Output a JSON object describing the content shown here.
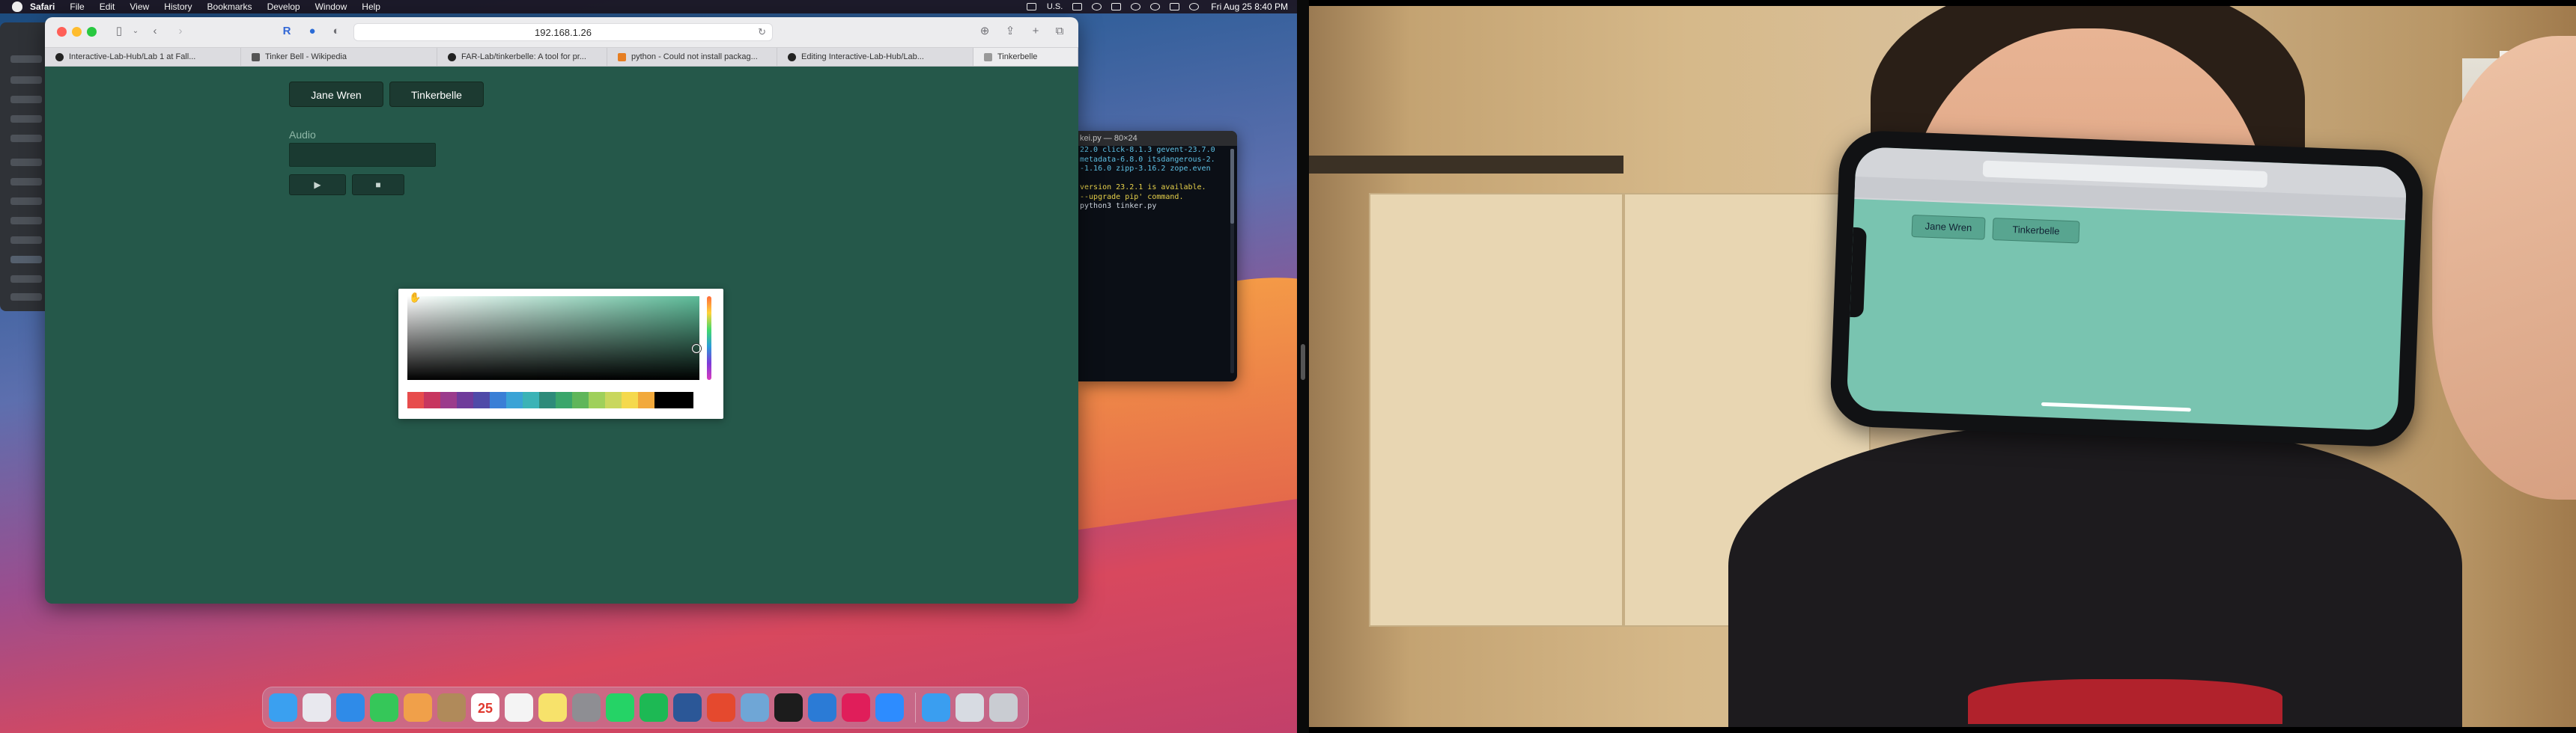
{
  "menubar": {
    "app_name": "Safari",
    "items": [
      "File",
      "Edit",
      "View",
      "History",
      "Bookmarks",
      "Develop",
      "Window",
      "Help"
    ],
    "input_language": "U.S.",
    "clock": "Fri Aug 25  8:40 PM"
  },
  "safari": {
    "address": "192.168.1.26",
    "tabs": [
      {
        "label": "Interactive-Lab-Hub/Lab 1 at Fall...",
        "favicon_color": "#222222"
      },
      {
        "label": "Tinker Bell - Wikipedia",
        "favicon_color": "#444444"
      },
      {
        "label": "FAR-Lab/tinkerbelle: A tool for pr...",
        "favicon_color": "#222222"
      },
      {
        "label": "python - Could not install packag...",
        "favicon_color": "#e67e22"
      },
      {
        "label": "Editing Interactive-Lab-Hub/Lab...",
        "favicon_color": "#222222"
      },
      {
        "label": "Tinkerbelle",
        "favicon_color": "#888888"
      }
    ]
  },
  "page": {
    "buttons": [
      "Jane Wren",
      "Tinkerbelle"
    ],
    "audio_label": "Audio",
    "play_icon": "play-icon",
    "stop_icon": "stop-icon",
    "background_color": "#25584a"
  },
  "color_picker": {
    "selected_hue_color": "#5cbb98",
    "swatches": [
      "#e74c4c",
      "#c7365f",
      "#9b3b8c",
      "#6f3b9b",
      "#4f4aa8",
      "#3a7fd6",
      "#3aa3d6",
      "#3bb3b6",
      "#2e8b7a",
      "#3aa66b",
      "#5fb65a",
      "#9fd05b",
      "#c9d75d",
      "#f5d94d",
      "#f2a93b",
      "#000000"
    ]
  },
  "terminal": {
    "title": "kei.py — 80×24",
    "lines": [
      {
        "text": "22.0 click-8.1.3 gevent-23.7.0",
        "color": "#5fc2e6"
      },
      {
        "text": "metadata-6.8.0 itsdangerous-2.",
        "color": "#5fc2e6"
      },
      {
        "text": "-1.16.0 zipp-3.16.2 zope.even",
        "color": "#5fc2e6"
      },
      {
        "text": "",
        "color": "#5fc2e6"
      },
      {
        "text": " version 23.2.1 is available.",
        "color": "#e7d14a"
      },
      {
        "text": "--upgrade pip' command.",
        "color": "#e7d14a"
      },
      {
        "text": "python3 tinker.py",
        "color": "#cfd6e0"
      }
    ]
  },
  "dock": {
    "apps": [
      {
        "name": "finder",
        "color": "#3aa0f0"
      },
      {
        "name": "launchpad",
        "color": "#e8e8ee"
      },
      {
        "name": "mail",
        "color": "#2f8be8"
      },
      {
        "name": "facetime",
        "color": "#35c759"
      },
      {
        "name": "photos",
        "color": "#f0a04a"
      },
      {
        "name": "contacts",
        "color": "#b08a5a"
      },
      {
        "name": "calendar",
        "color": "#ffffff"
      },
      {
        "name": "reminders",
        "color": "#f4f4f4"
      },
      {
        "name": "notes",
        "color": "#f7e26b"
      },
      {
        "name": "system-preferences",
        "color": "#8e8e93"
      },
      {
        "name": "whatsapp",
        "color": "#25d366"
      },
      {
        "name": "spotify",
        "color": "#1db954"
      },
      {
        "name": "word",
        "color": "#2b5797"
      },
      {
        "name": "chrome",
        "color": "#e5492e"
      },
      {
        "name": "preview",
        "color": "#6fa6d6"
      },
      {
        "name": "terminal",
        "color": "#1c1c1c"
      },
      {
        "name": "xcode",
        "color": "#2b7bd6"
      },
      {
        "name": "slack",
        "color": "#e01e5a"
      },
      {
        "name": "zoom",
        "color": "#2d8cff"
      },
      {
        "name": "safari",
        "color": "#3a9ef0"
      },
      {
        "name": "downloads",
        "color": "#d7dbe2"
      },
      {
        "name": "trash",
        "color": "#c9ccd2"
      }
    ],
    "calendar_day": "25"
  },
  "phone_view": {
    "buttons": [
      "Jane Wren",
      "Tinkerbelle"
    ],
    "screen_color": "#79c4b0"
  }
}
